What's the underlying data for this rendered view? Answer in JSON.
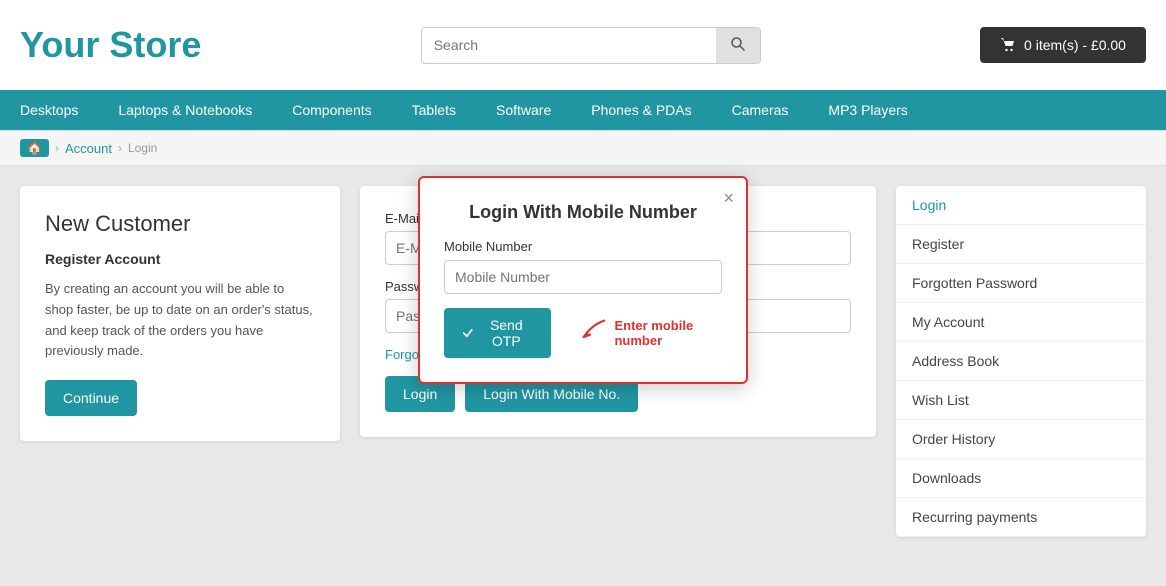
{
  "header": {
    "store_title": "Your Store",
    "search_placeholder": "Search",
    "cart_label": "0 item(s) - £0.00"
  },
  "nav": {
    "items": [
      "Desktops",
      "Laptops & Notebooks",
      "Components",
      "Tablets",
      "Software",
      "Phones & PDAs",
      "Cameras",
      "MP3 Players"
    ]
  },
  "breadcrumb": {
    "home": "🏠",
    "account": "Account",
    "current": "Login"
  },
  "left_panel": {
    "title": "New Customer",
    "subtitle": "Register Account",
    "description": "By creating an account you will be able to shop faster, be up to date on an order's status, and keep track of the orders you have previously made.",
    "continue_label": "Continue"
  },
  "login_form": {
    "email_label": "E-Mail",
    "email_placeholder": "E-Mail",
    "password_label": "Password",
    "password_placeholder": "Password",
    "forgot_label": "Forgotten Password",
    "login_label": "Login",
    "login_mobile_label": "Login With Mobile No."
  },
  "sidebar": {
    "items": [
      "Login",
      "Register",
      "Forgotten Password",
      "My Account",
      "Address Book",
      "Wish List",
      "Order History",
      "Downloads",
      "Recurring payments"
    ]
  },
  "modal": {
    "title": "Login With Mobile Number",
    "mobile_label": "Mobile Number",
    "mobile_placeholder": "Mobile Number",
    "send_otp_label": "Send OTP",
    "hint_text": "Enter mobile number",
    "close_label": "×"
  }
}
